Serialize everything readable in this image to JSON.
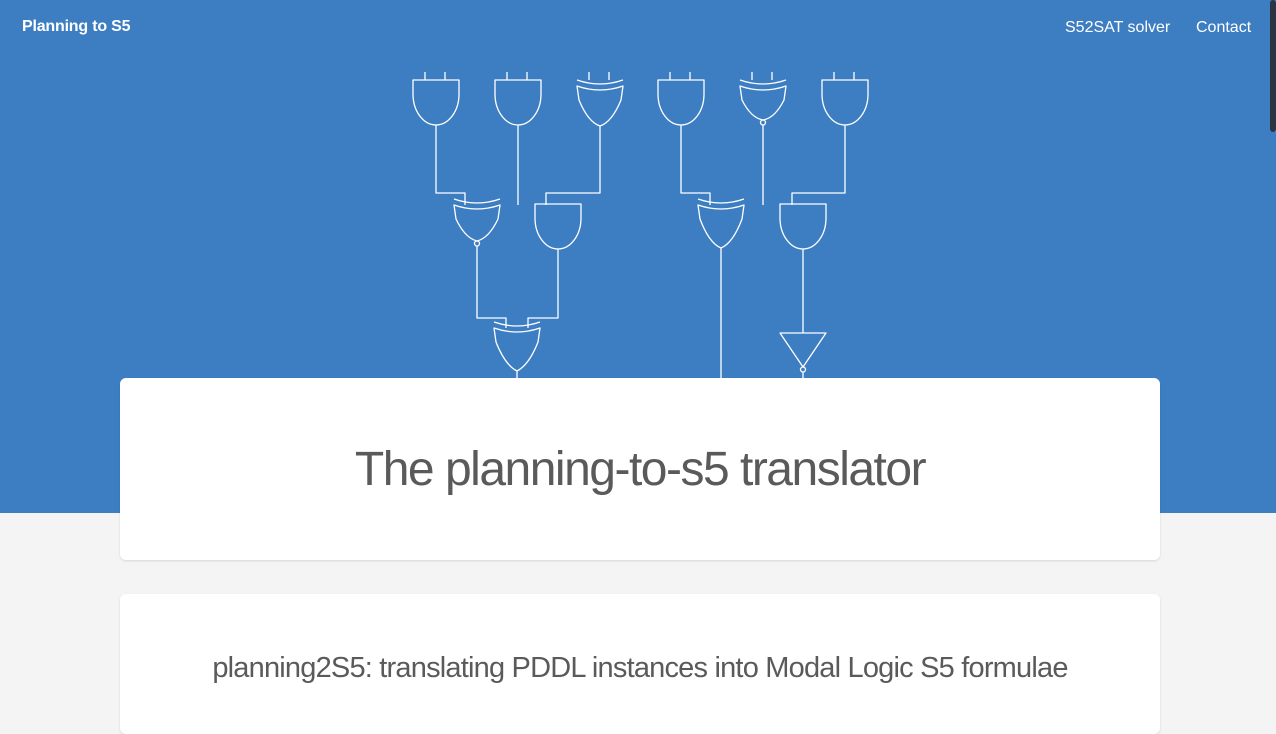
{
  "navbar": {
    "brand": "Planning to S5",
    "links": [
      {
        "label": "S52SAT solver"
      },
      {
        "label": "Contact"
      }
    ]
  },
  "hero": {
    "title": "The planning-to-s5 translator",
    "illustration": "logic-gate-circuit"
  },
  "intro": {
    "heading": "planning2S5: translating PDDL instances into Modal Logic S5 formulae"
  },
  "colors": {
    "hero_background": "#3d7ec3",
    "page_background": "#f4f4f4",
    "card_background": "#ffffff",
    "heading_text": "#5a5a5a",
    "nav_text": "#ffffff"
  }
}
